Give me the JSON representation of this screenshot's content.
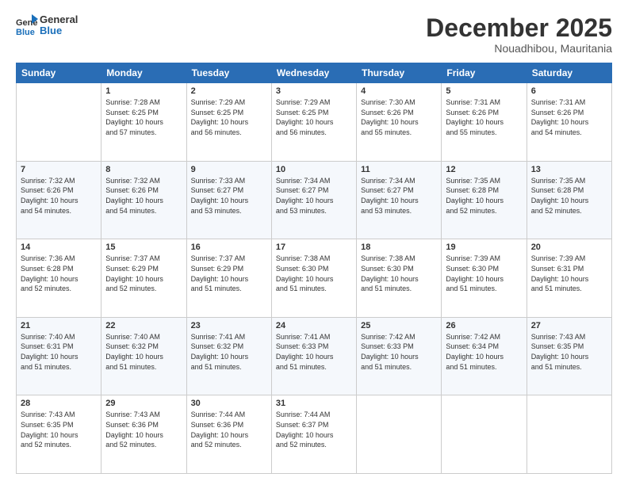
{
  "logo": {
    "line1": "General",
    "line2": "Blue"
  },
  "title": "December 2025",
  "location": "Nouadhibou, Mauritania",
  "header_days": [
    "Sunday",
    "Monday",
    "Tuesday",
    "Wednesday",
    "Thursday",
    "Friday",
    "Saturday"
  ],
  "weeks": [
    [
      {
        "day": "",
        "content": ""
      },
      {
        "day": "1",
        "content": "Sunrise: 7:28 AM\nSunset: 6:25 PM\nDaylight: 10 hours\nand 57 minutes."
      },
      {
        "day": "2",
        "content": "Sunrise: 7:29 AM\nSunset: 6:25 PM\nDaylight: 10 hours\nand 56 minutes."
      },
      {
        "day": "3",
        "content": "Sunrise: 7:29 AM\nSunset: 6:25 PM\nDaylight: 10 hours\nand 56 minutes."
      },
      {
        "day": "4",
        "content": "Sunrise: 7:30 AM\nSunset: 6:26 PM\nDaylight: 10 hours\nand 55 minutes."
      },
      {
        "day": "5",
        "content": "Sunrise: 7:31 AM\nSunset: 6:26 PM\nDaylight: 10 hours\nand 55 minutes."
      },
      {
        "day": "6",
        "content": "Sunrise: 7:31 AM\nSunset: 6:26 PM\nDaylight: 10 hours\nand 54 minutes."
      }
    ],
    [
      {
        "day": "7",
        "content": "Sunrise: 7:32 AM\nSunset: 6:26 PM\nDaylight: 10 hours\nand 54 minutes."
      },
      {
        "day": "8",
        "content": "Sunrise: 7:32 AM\nSunset: 6:26 PM\nDaylight: 10 hours\nand 54 minutes."
      },
      {
        "day": "9",
        "content": "Sunrise: 7:33 AM\nSunset: 6:27 PM\nDaylight: 10 hours\nand 53 minutes."
      },
      {
        "day": "10",
        "content": "Sunrise: 7:34 AM\nSunset: 6:27 PM\nDaylight: 10 hours\nand 53 minutes."
      },
      {
        "day": "11",
        "content": "Sunrise: 7:34 AM\nSunset: 6:27 PM\nDaylight: 10 hours\nand 53 minutes."
      },
      {
        "day": "12",
        "content": "Sunrise: 7:35 AM\nSunset: 6:28 PM\nDaylight: 10 hours\nand 52 minutes."
      },
      {
        "day": "13",
        "content": "Sunrise: 7:35 AM\nSunset: 6:28 PM\nDaylight: 10 hours\nand 52 minutes."
      }
    ],
    [
      {
        "day": "14",
        "content": "Sunrise: 7:36 AM\nSunset: 6:28 PM\nDaylight: 10 hours\nand 52 minutes."
      },
      {
        "day": "15",
        "content": "Sunrise: 7:37 AM\nSunset: 6:29 PM\nDaylight: 10 hours\nand 52 minutes."
      },
      {
        "day": "16",
        "content": "Sunrise: 7:37 AM\nSunset: 6:29 PM\nDaylight: 10 hours\nand 51 minutes."
      },
      {
        "day": "17",
        "content": "Sunrise: 7:38 AM\nSunset: 6:30 PM\nDaylight: 10 hours\nand 51 minutes."
      },
      {
        "day": "18",
        "content": "Sunrise: 7:38 AM\nSunset: 6:30 PM\nDaylight: 10 hours\nand 51 minutes."
      },
      {
        "day": "19",
        "content": "Sunrise: 7:39 AM\nSunset: 6:30 PM\nDaylight: 10 hours\nand 51 minutes."
      },
      {
        "day": "20",
        "content": "Sunrise: 7:39 AM\nSunset: 6:31 PM\nDaylight: 10 hours\nand 51 minutes."
      }
    ],
    [
      {
        "day": "21",
        "content": "Sunrise: 7:40 AM\nSunset: 6:31 PM\nDaylight: 10 hours\nand 51 minutes."
      },
      {
        "day": "22",
        "content": "Sunrise: 7:40 AM\nSunset: 6:32 PM\nDaylight: 10 hours\nand 51 minutes."
      },
      {
        "day": "23",
        "content": "Sunrise: 7:41 AM\nSunset: 6:32 PM\nDaylight: 10 hours\nand 51 minutes."
      },
      {
        "day": "24",
        "content": "Sunrise: 7:41 AM\nSunset: 6:33 PM\nDaylight: 10 hours\nand 51 minutes."
      },
      {
        "day": "25",
        "content": "Sunrise: 7:42 AM\nSunset: 6:33 PM\nDaylight: 10 hours\nand 51 minutes."
      },
      {
        "day": "26",
        "content": "Sunrise: 7:42 AM\nSunset: 6:34 PM\nDaylight: 10 hours\nand 51 minutes."
      },
      {
        "day": "27",
        "content": "Sunrise: 7:43 AM\nSunset: 6:35 PM\nDaylight: 10 hours\nand 51 minutes."
      }
    ],
    [
      {
        "day": "28",
        "content": "Sunrise: 7:43 AM\nSunset: 6:35 PM\nDaylight: 10 hours\nand 52 minutes."
      },
      {
        "day": "29",
        "content": "Sunrise: 7:43 AM\nSunset: 6:36 PM\nDaylight: 10 hours\nand 52 minutes."
      },
      {
        "day": "30",
        "content": "Sunrise: 7:44 AM\nSunset: 6:36 PM\nDaylight: 10 hours\nand 52 minutes."
      },
      {
        "day": "31",
        "content": "Sunrise: 7:44 AM\nSunset: 6:37 PM\nDaylight: 10 hours\nand 52 minutes."
      },
      {
        "day": "",
        "content": ""
      },
      {
        "day": "",
        "content": ""
      },
      {
        "day": "",
        "content": ""
      }
    ]
  ]
}
